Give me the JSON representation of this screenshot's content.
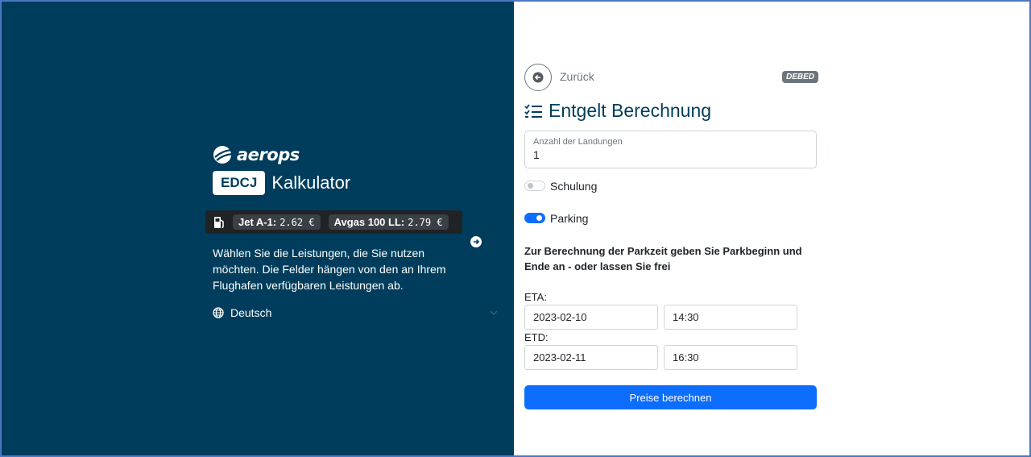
{
  "brand": {
    "name": "aerops"
  },
  "header": {
    "airport_code": "EDCJ",
    "title": "Kalkulator"
  },
  "fuel": [
    {
      "label": "Jet A-1:",
      "price": "2.62 €"
    },
    {
      "label": "Avgas 100 LL:",
      "price": "2.79 €"
    }
  ],
  "intro": {
    "text": "Wählen Sie die Leistungen, die Sie nutzen möchten. Die Felder hängen von den an Ihrem Flughafen verfügbaren Leistungen ab."
  },
  "language": {
    "selected": "Deutsch"
  },
  "nav": {
    "back_label": "Zurück",
    "code_badge": "DEBED"
  },
  "form": {
    "heading": "Entgelt Berechnung",
    "landings": {
      "label": "Anzahl der Landungen",
      "value": "1"
    },
    "training": {
      "label": "Schulung",
      "enabled": false
    },
    "parking": {
      "label": "Parking",
      "enabled": true
    },
    "parking_info": "Zur Berechnung der Parkzeit geben Sie Parkbeginn und Ende an - oder lassen Sie frei",
    "eta": {
      "label": "ETA:",
      "date": "2023-02-10",
      "time": "14:30"
    },
    "etd": {
      "label": "ETD:",
      "date": "2023-02-11",
      "time": "16:30"
    },
    "submit_label": "Preise berechnen"
  },
  "colors": {
    "left_panel": "#003d5c",
    "primary": "#0d6efd",
    "badge": "#6c757d"
  }
}
